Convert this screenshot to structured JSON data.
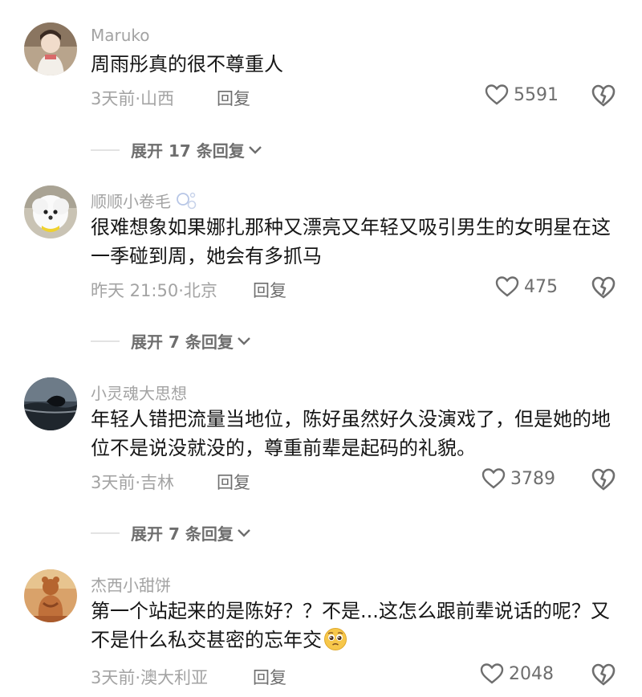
{
  "comments": [
    {
      "username": "Maruko",
      "content": "周雨彤真的很不尊重人",
      "meta": "3天前·山西",
      "reply_label": "回复",
      "likes": "5591",
      "expand_label": "展开 17 条回复"
    },
    {
      "username": "顺顺小卷毛",
      "content": "很难想象如果娜扎那种又漂亮又年轻又吸引男生的女明星在这一季碰到周，她会有多抓马",
      "meta": "昨天 21:50·北京",
      "reply_label": "回复",
      "likes": "475",
      "expand_label": "展开 7 条回复"
    },
    {
      "username": "小灵魂大思想",
      "content": "年轻人错把流量当地位，陈好虽然好久没演戏了，但是她的地位不是说没就没的，尊重前辈是起码的礼貌。",
      "meta": "3天前·吉林",
      "reply_label": "回复",
      "likes": "3789",
      "expand_label": "展开 7 条回复"
    },
    {
      "username": "杰西小甜饼",
      "content": "第一个站起来的是陈好？？不是...这怎么跟前辈说话的呢？又不是什么私交甚密的忘年交",
      "meta": "3天前·澳大利亚",
      "reply_label": "回复",
      "likes": "2048"
    }
  ],
  "icons": {
    "like": "heart-outline-icon",
    "dislike": "broken-heart-icon",
    "expand": "chevron-down-icon",
    "username_badge": "bubbles-icon",
    "inline_emoji": "pleading-face-emoji"
  },
  "colors": {
    "username": "#a3a3a3",
    "text": "#161616",
    "secondary": "#6e6e6e"
  }
}
